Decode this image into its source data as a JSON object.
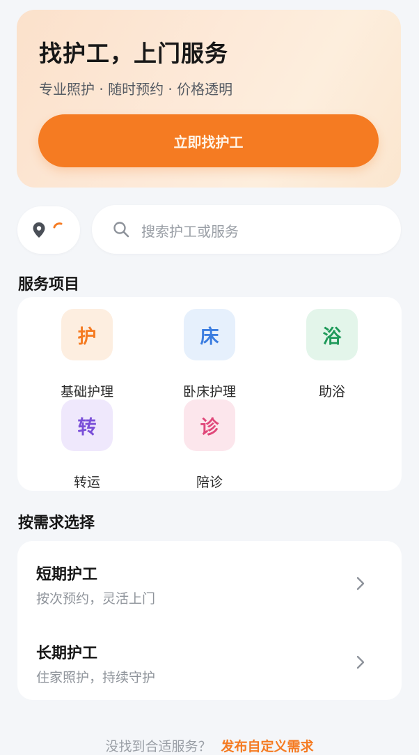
{
  "hero": {
    "title": "找护工，上门服务",
    "subtitle": "专业照护 · 随时预约 · 价格透明",
    "button_label": "立即找护工"
  },
  "search": {
    "placeholder": "搜索护工或服务"
  },
  "services": {
    "title": "服务项目",
    "items": [
      {
        "glyph": "护",
        "label": "基础护理",
        "color": "#f57b22",
        "bg": "#fdeee0"
      },
      {
        "glyph": "床",
        "label": "卧床护理",
        "color": "#3b7de0",
        "bg": "#e6f0fc"
      },
      {
        "glyph": "浴",
        "label": "助浴",
        "color": "#1f9a5a",
        "bg": "#e3f5ea"
      },
      {
        "glyph": "转",
        "label": "转运",
        "color": "#7a4fd8",
        "bg": "#efe8fc"
      },
      {
        "glyph": "诊",
        "label": "陪诊",
        "color": "#e0487a",
        "bg": "#fce6ec"
      }
    ]
  },
  "needs": {
    "title": "按需求选择",
    "items": [
      {
        "title": "短期护工",
        "desc": "按次预约，灵活上门"
      },
      {
        "title": "长期护工",
        "desc": "住家照护，持续守护"
      }
    ]
  },
  "footer": {
    "prompt": "没找到合适服务？",
    "link": "发布自定义需求"
  },
  "colors": {
    "accent": "#f57b22",
    "background": "#f4f6f9"
  }
}
